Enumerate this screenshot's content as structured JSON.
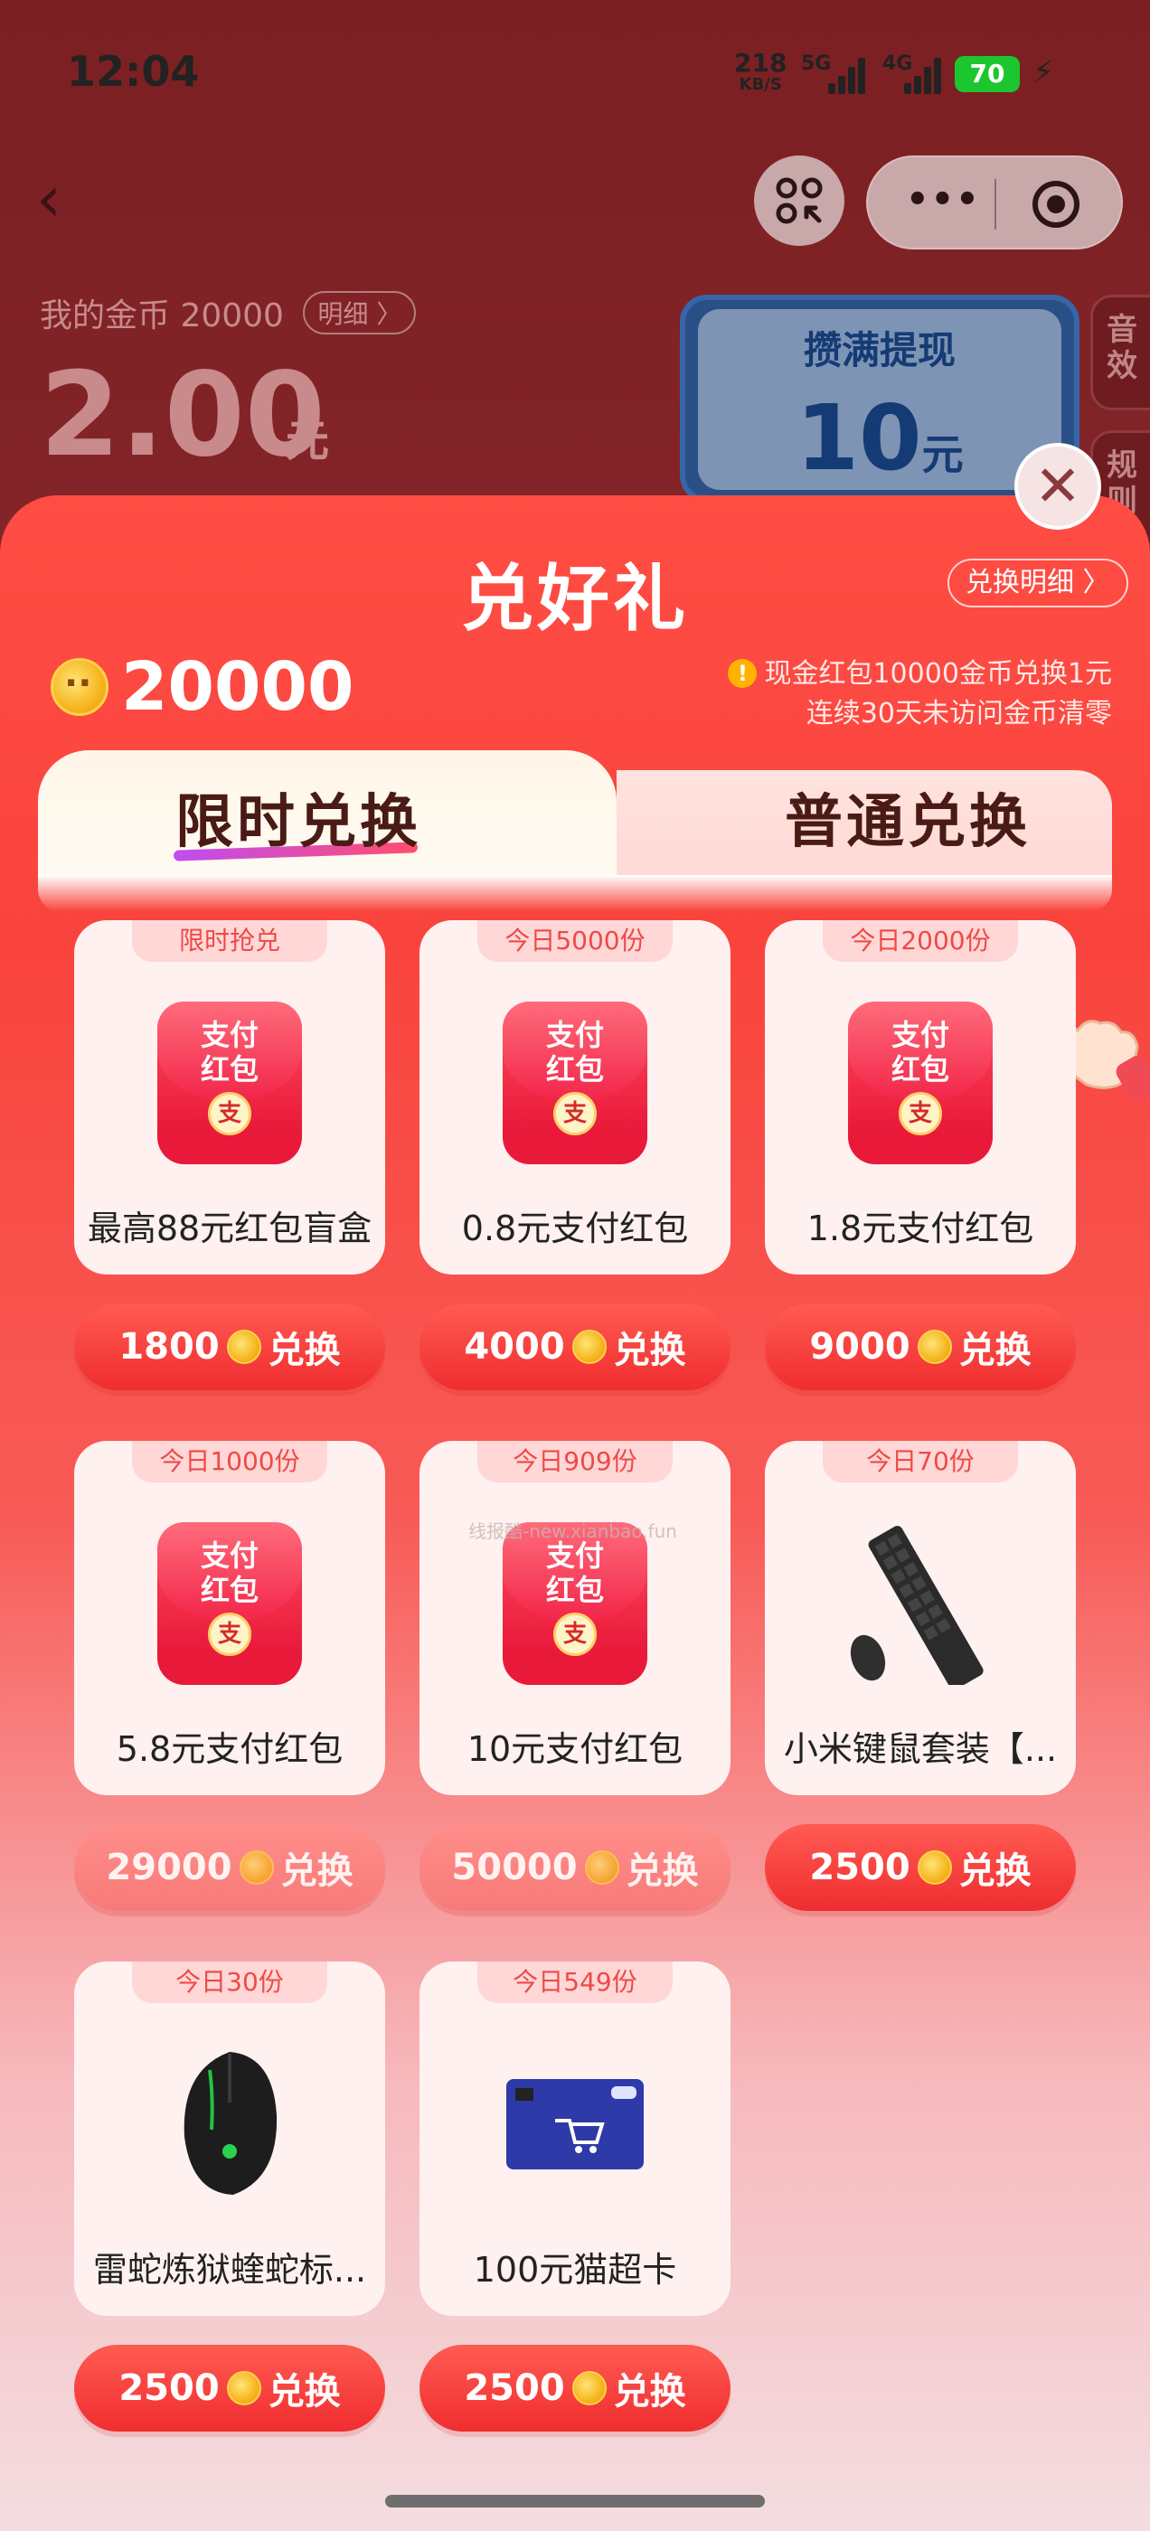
{
  "status_bar": {
    "time": "12:04",
    "net_speed_value": "218",
    "net_speed_unit": "KB/S",
    "signal_1_label": "5G",
    "signal_2_label": "4G",
    "battery": "70"
  },
  "page": {
    "coins_label": "我的金币 20000",
    "coins_detail": "明细",
    "balance_amount": "2.00",
    "balance_unit": "元",
    "withdraw_title": "攒满提现",
    "withdraw_value": "10",
    "withdraw_unit": "元",
    "side_tab_1": "音效",
    "side_tab_2": "规则"
  },
  "modal": {
    "title": "兑好礼",
    "detail_link": "兑换明细 〉",
    "coin_balance": "20000",
    "notice_line_1": "现金红包10000金币兑换1元",
    "notice_line_2": "连续30天未访问金币清零",
    "tabs": [
      {
        "label": "限时兑换",
        "active": true
      },
      {
        "label": "普通兑换",
        "active": false
      }
    ],
    "items": [
      {
        "badge": "限时抢兑",
        "name": "最高88元红包盲盒",
        "price": "1800",
        "action": "兑换",
        "icon": "red-packet",
        "packet_text": "支付红包",
        "available": true
      },
      {
        "badge": "今日5000份",
        "name": "0.8元支付红包",
        "price": "4000",
        "action": "兑换",
        "icon": "red-packet",
        "packet_text": "支付红包",
        "available": true
      },
      {
        "badge": "今日2000份",
        "name": "1.8元支付红包",
        "price": "9000",
        "action": "兑换",
        "icon": "red-packet",
        "packet_text": "支付红包",
        "available": true
      },
      {
        "badge": "今日1000份",
        "name": "5.8元支付红包",
        "price": "29000",
        "action": "兑换",
        "icon": "red-packet",
        "packet_text": "支付红包",
        "available": false
      },
      {
        "badge": "今日909份",
        "name": "10元支付红包",
        "price": "50000",
        "action": "兑换",
        "icon": "red-packet",
        "packet_text": "支付红包",
        "available": false
      },
      {
        "badge": "今日70份",
        "name": "小米键鼠套装【...",
        "price": "2500",
        "action": "兑换",
        "icon": "keyboard-mouse",
        "available": true
      },
      {
        "badge": "今日30份",
        "name": "雷蛇炼狱蝰蛇标...",
        "price": "2500",
        "action": "兑换",
        "icon": "gaming-mouse",
        "available": true
      },
      {
        "badge": "今日549份",
        "name": "100元猫超卡",
        "price": "2500",
        "action": "兑换",
        "icon": "gift-card",
        "available": true
      }
    ],
    "watermark": "线报酷-new.xianbao.fun"
  },
  "colors": {
    "accent_red": "#f02d2f",
    "faded_red": "#f77a78",
    "badge_text": "#ed4a48",
    "coin_gold": "#f6b51f"
  }
}
